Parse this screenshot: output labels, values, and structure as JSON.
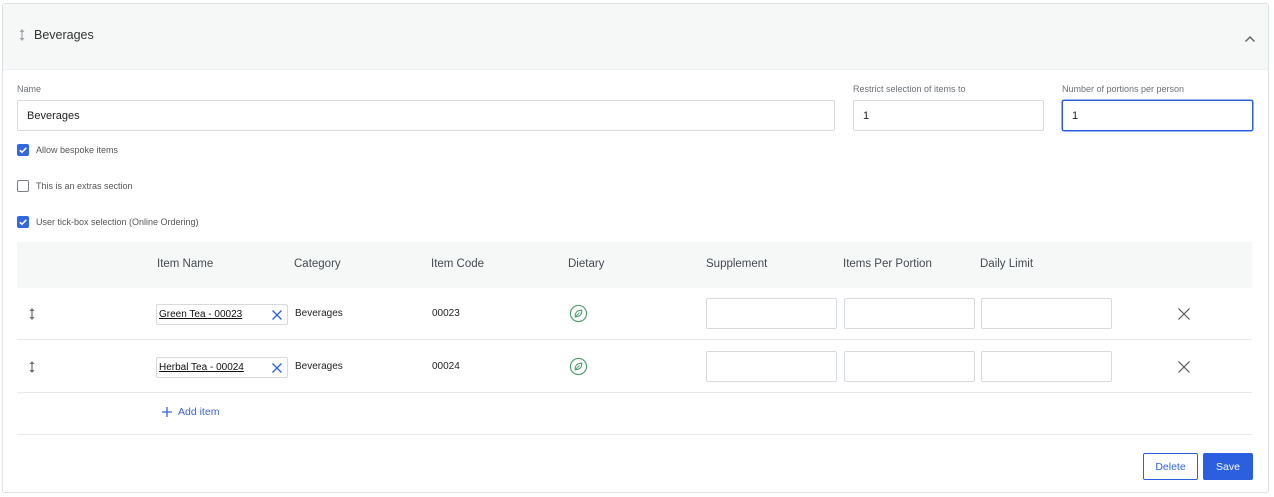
{
  "section": {
    "title": "Beverages"
  },
  "form": {
    "name_label": "Name",
    "name_value": "Beverages",
    "restrict_label": "Restrict selection of items to",
    "restrict_value": "1",
    "portions_label": "Number of portions per person",
    "portions_value": "1"
  },
  "options": [
    {
      "label": "Allow bespoke items",
      "checked": true
    },
    {
      "label": "This is an extras section",
      "checked": false
    },
    {
      "label": "User tick-box selection (Online Ordering)",
      "checked": true
    }
  ],
  "table": {
    "columns": [
      "Item Name",
      "Category",
      "Item Code",
      "Dietary",
      "Supplement",
      "Items Per Portion",
      "Daily Limit"
    ],
    "rows": [
      {
        "item_name": "Green Tea - 00023",
        "category": "Beverages",
        "item_code": "00023",
        "dietary_icon": "vegan-leaf-icon",
        "supplement": "",
        "items_per_portion": "",
        "daily_limit": ""
      },
      {
        "item_name": "Herbal Tea - 00024",
        "category": "Beverages",
        "item_code": "00024",
        "dietary_icon": "vegan-leaf-icon",
        "supplement": "",
        "items_per_portion": "",
        "daily_limit": ""
      }
    ],
    "add_item_label": "Add item"
  },
  "actions": {
    "delete_label": "Delete",
    "save_label": "Save"
  },
  "colors": {
    "accent": "#2b5fe0",
    "header_bg": "#f6f8f8",
    "diet_green": "#4e9a6a"
  }
}
